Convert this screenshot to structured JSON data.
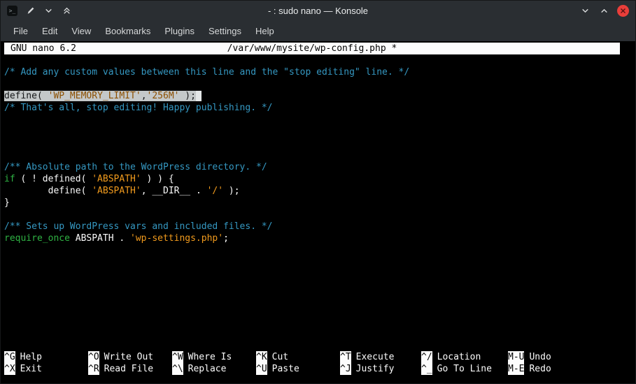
{
  "colors": {
    "chrome_bg": "#2a2e32",
    "terminal_bg": "#000000",
    "nano_bar_bg": "#fcfcfc",
    "comment": "#3598c2",
    "string": "#f29b1d",
    "keyword": "#2fb344",
    "selection_bg": "#c4c8c9",
    "close": "#e93e3a"
  },
  "titlebar": {
    "title": "- : sudo nano — Konsole",
    "left_icons": [
      "konsole-icon",
      "pen-icon",
      "keep-below-icon",
      "keep-above-icon"
    ],
    "right_icons": [
      "minimize-icon",
      "maximize-icon",
      "close-icon"
    ],
    "konsole_glyph": ">_"
  },
  "menu": {
    "items": [
      "File",
      "Edit",
      "View",
      "Bookmarks",
      "Plugins",
      "Settings",
      "Help"
    ]
  },
  "nano_header": {
    "app": "GNU nano 6.2",
    "file": "/var/www/mysite/wp-config.php *"
  },
  "editor": {
    "lines": [
      {
        "segments": []
      },
      {
        "segments": [
          {
            "t": "/* Add any custom values between this line and the \"stop editing\" line. */",
            "c": "comment"
          }
        ]
      },
      {
        "segments": []
      },
      {
        "segments": [
          {
            "t": "define( ",
            "c": "sel"
          },
          {
            "t": "'WP_MEMORY_LIMIT'",
            "c": "selstring"
          },
          {
            "t": ",",
            "c": "sel"
          },
          {
            "t": "'256M'",
            "c": "selstring"
          },
          {
            "t": " );",
            "c": "sel"
          }
        ],
        "cursor": true
      },
      {
        "segments": [
          {
            "t": "/* That's all, stop editing! Happy publishing. */",
            "c": "comment"
          }
        ]
      },
      {
        "segments": []
      },
      {
        "segments": []
      },
      {
        "segments": []
      },
      {
        "segments": []
      },
      {
        "segments": [
          {
            "t": "/** Absolute path to the WordPress directory. */",
            "c": "comment"
          }
        ]
      },
      {
        "segments": [
          {
            "t": "if",
            "c": "keyword"
          },
          {
            "t": " ( ! defined( ",
            "c": "plain"
          },
          {
            "t": "'ABSPATH'",
            "c": "string"
          },
          {
            "t": " ) ) {",
            "c": "plain"
          }
        ]
      },
      {
        "segments": [
          {
            "t": "        define( ",
            "c": "plain"
          },
          {
            "t": "'ABSPATH'",
            "c": "string"
          },
          {
            "t": ", __DIR__ . ",
            "c": "plain"
          },
          {
            "t": "'/'",
            "c": "string"
          },
          {
            "t": " );",
            "c": "plain"
          }
        ]
      },
      {
        "segments": [
          {
            "t": "}",
            "c": "plain"
          }
        ]
      },
      {
        "segments": []
      },
      {
        "segments": [
          {
            "t": "/** Sets up WordPress vars and included files. */",
            "c": "comment"
          }
        ]
      },
      {
        "segments": [
          {
            "t": "require_once",
            "c": "keyword"
          },
          {
            "t": " ABSPATH . ",
            "c": "plain"
          },
          {
            "t": "'wp-settings.php'",
            "c": "string"
          },
          {
            "t": ";",
            "c": "plain"
          }
        ]
      }
    ]
  },
  "shortcuts": {
    "rows": [
      [
        {
          "key": "^G",
          "label": "Help"
        },
        {
          "key": "^O",
          "label": "Write Out"
        },
        {
          "key": "^W",
          "label": "Where Is"
        },
        {
          "key": "^K",
          "label": "Cut"
        },
        {
          "key": "^T",
          "label": "Execute"
        },
        {
          "key": "^/",
          "label": "Location"
        },
        {
          "key": "M-U",
          "label": "Undo"
        }
      ],
      [
        {
          "key": "^X",
          "label": "Exit"
        },
        {
          "key": "^R",
          "label": "Read File"
        },
        {
          "key": "^\\",
          "label": "Replace"
        },
        {
          "key": "^U",
          "label": "Paste"
        },
        {
          "key": "^J",
          "label": "Justify"
        },
        {
          "key": "^_",
          "label": "Go To Line"
        },
        {
          "key": "M-E",
          "label": "Redo"
        }
      ]
    ]
  }
}
